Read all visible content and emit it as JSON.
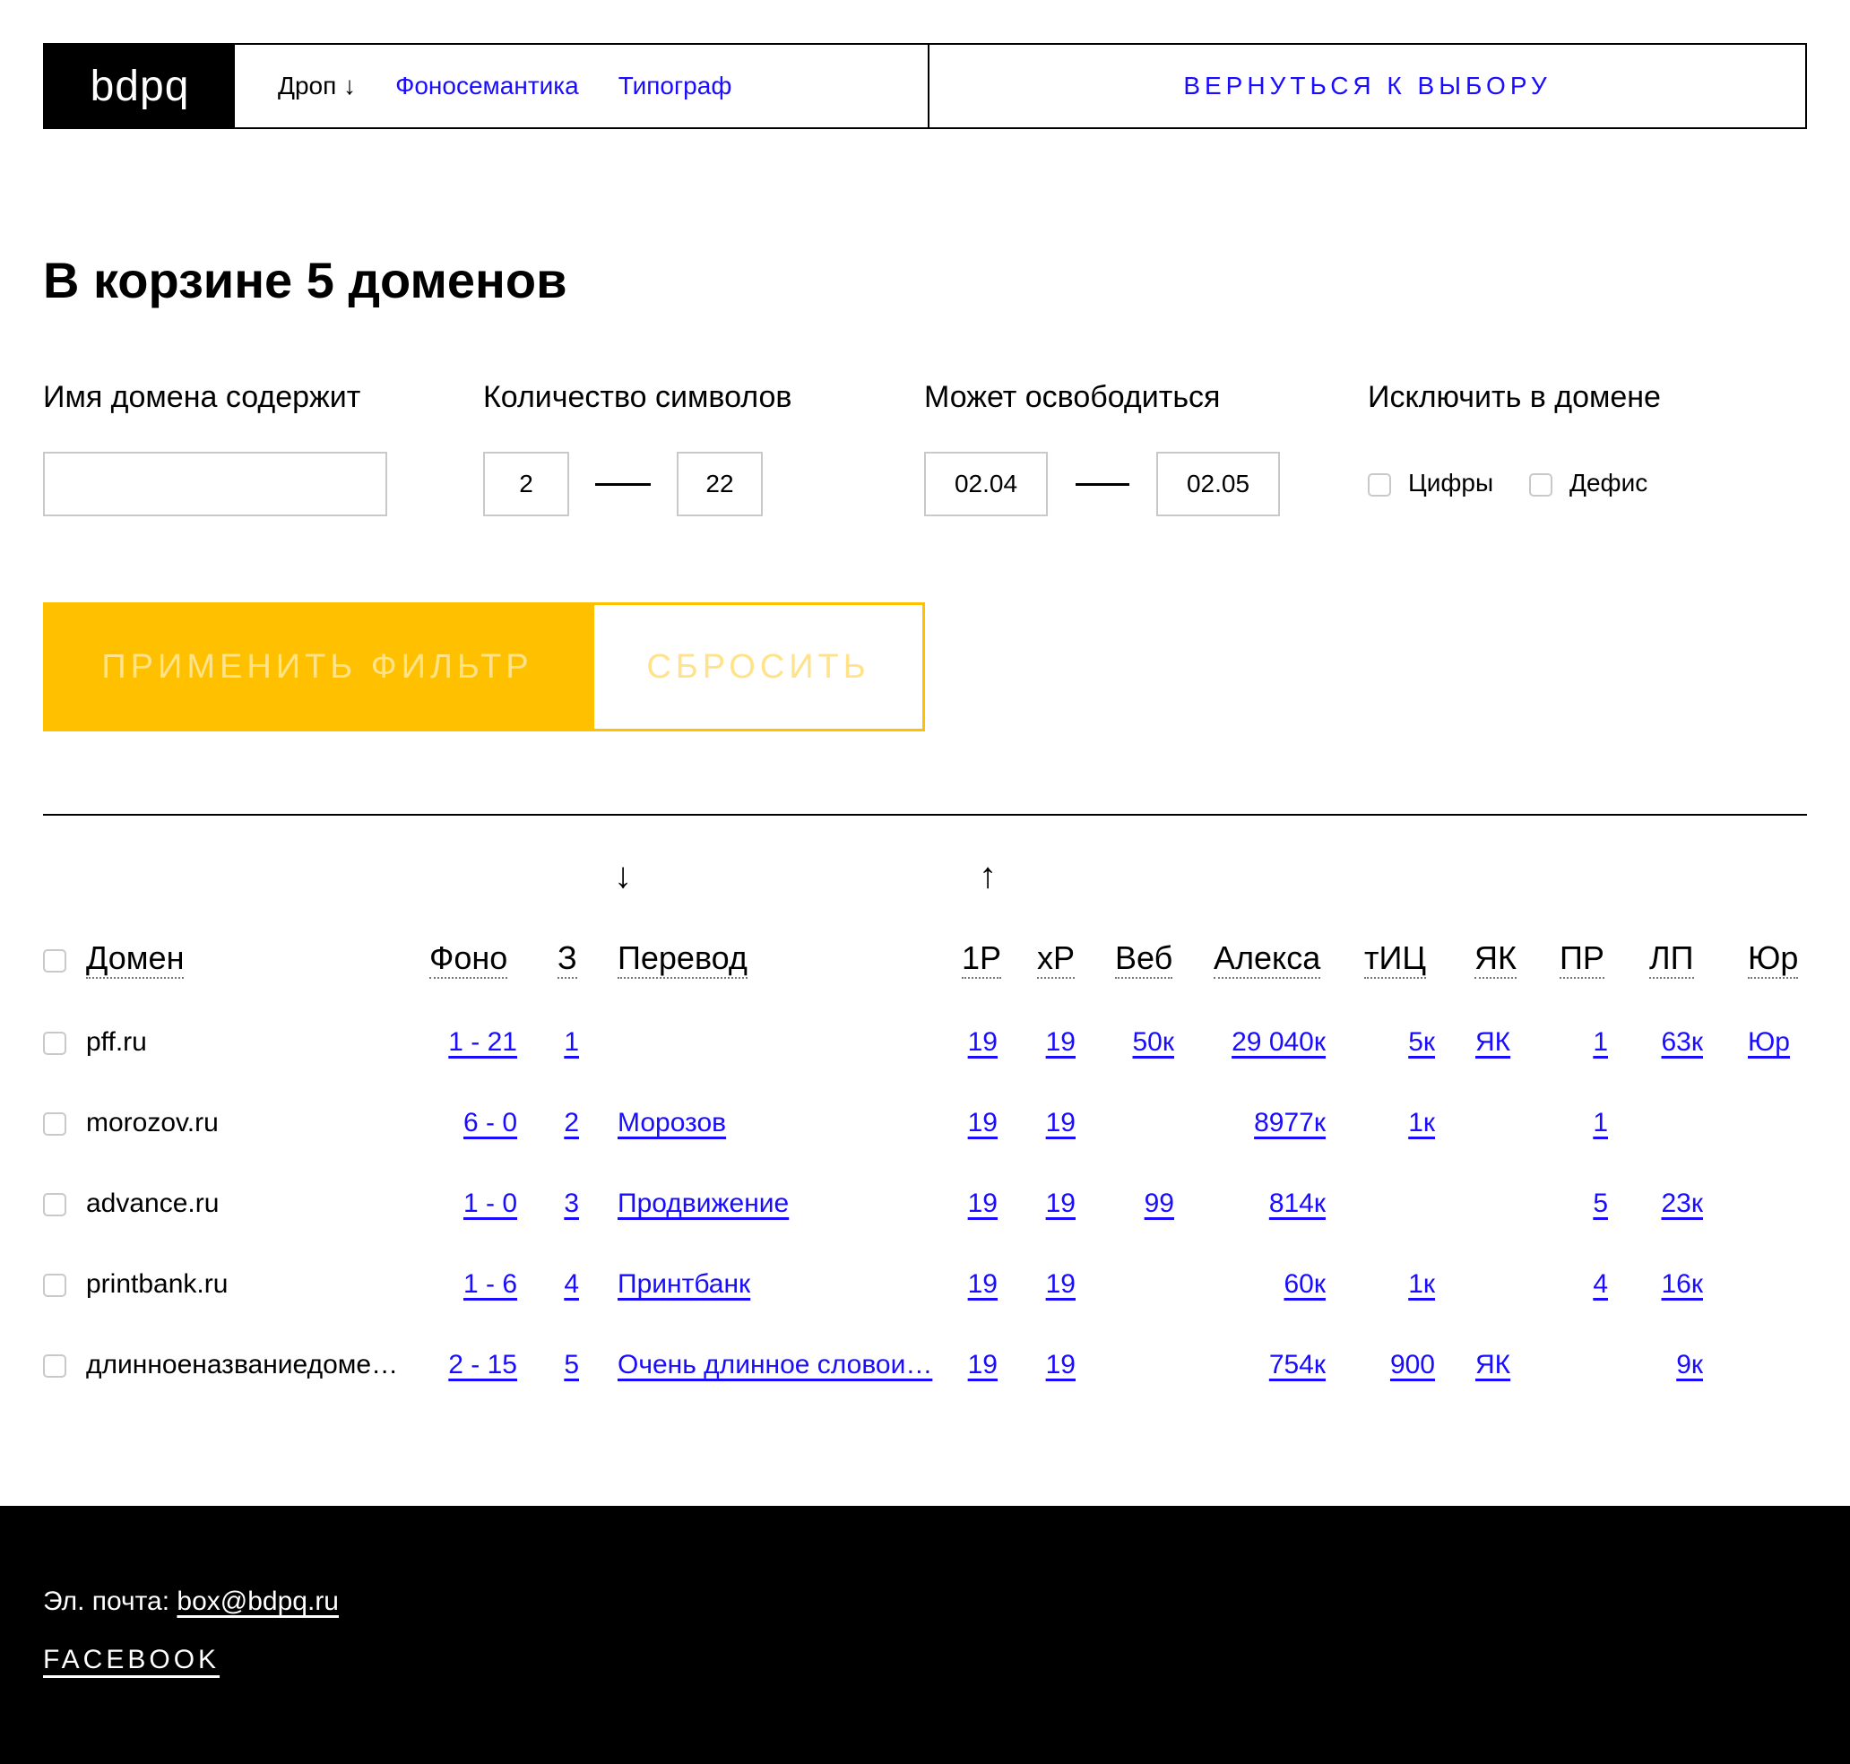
{
  "header": {
    "logo": "bdpq",
    "nav": [
      {
        "label": "Дроп ↓",
        "current": true
      },
      {
        "label": "Фоносемантика",
        "current": false
      },
      {
        "label": "Типограф",
        "current": false
      }
    ],
    "back_label": "ВЕРНУТЬСЯ К ВЫБОРУ"
  },
  "title": "В корзине 5 доменов",
  "filters": {
    "name_label": "Имя домена содержит",
    "name_value": "",
    "length_label": "Количество символов",
    "length_from": "2",
    "length_to": "22",
    "release_label": "Может освободиться",
    "release_from": "02.04",
    "release_to": "02.05",
    "exclude_label": "Исключить в домене",
    "exclude_digits": "Цифры",
    "exclude_hyphen": "Дефис",
    "apply_label": "ПРИМЕНИТЬ ФИЛЬТР",
    "reset_label": "СБРОСИТЬ"
  },
  "sort_arrows": {
    "translation": "↓",
    "p1": "↑"
  },
  "table": {
    "headers": {
      "domain": "Домен",
      "fono": "Фоно",
      "z": "З",
      "translation": "Перевод",
      "p1": "1Р",
      "xp": "хР",
      "web": "Веб",
      "alexa": "Алекса",
      "tic": "тИЦ",
      "yak": "ЯК",
      "pr": "ПР",
      "lp": "ЛП",
      "yur": "Юр"
    },
    "rows": [
      {
        "domain": "pff.ru",
        "fono": "1 - 21",
        "z": "1",
        "translation": "",
        "p1": "19",
        "xp": "19",
        "web": "50к",
        "alexa": "29 040к",
        "tic": "5к",
        "yak": "ЯК",
        "pr": "1",
        "lp": "63к",
        "yur": "Юр"
      },
      {
        "domain": "morozov.ru",
        "fono": "6 - 0",
        "z": "2",
        "translation": "Морозов",
        "p1": "19",
        "xp": "19",
        "web": "",
        "alexa": "8977к",
        "tic": "1к",
        "yak": "",
        "pr": "1",
        "lp": "",
        "yur": ""
      },
      {
        "domain": "advance.ru",
        "fono": "1 - 0",
        "z": "3",
        "translation": "Продвижение",
        "p1": "19",
        "xp": "19",
        "web": "99",
        "alexa": "814к",
        "tic": "",
        "yak": "",
        "pr": "5",
        "lp": "23к",
        "yur": ""
      },
      {
        "domain": "printbank.ru",
        "fono": "1 - 6",
        "z": "4",
        "translation": "Принтбанк",
        "p1": "19",
        "xp": "19",
        "web": "",
        "alexa": "60к",
        "tic": "1к",
        "yak": "",
        "pr": "4",
        "lp": "16к",
        "yur": ""
      },
      {
        "domain": "длинноеназваниедоме…",
        "fono": "2 - 15",
        "z": "5",
        "translation": "Очень длинное словои…",
        "p1": "19",
        "xp": "19",
        "web": "",
        "alexa": "754к",
        "tic": "900",
        "yak": "ЯК",
        "pr": "",
        "lp": "9к",
        "yur": ""
      }
    ]
  },
  "footer": {
    "mail_label": "Эл. почта:",
    "mail": "box@bdpq.ru",
    "facebook": "FACEBOOK"
  }
}
